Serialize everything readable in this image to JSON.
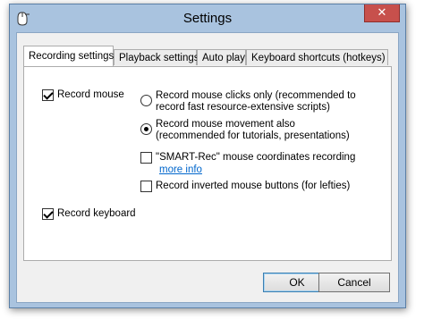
{
  "window": {
    "title": "Settings",
    "close_glyph": "✕"
  },
  "tabs": [
    {
      "label": "Recording settings",
      "active": true
    },
    {
      "label": "Playback settings",
      "active": false
    },
    {
      "label": "Auto play",
      "active": false
    },
    {
      "label": "Keyboard shortcuts (hotkeys)",
      "active": false
    }
  ],
  "options": {
    "record_mouse": {
      "label": "Record mouse",
      "checked": true
    },
    "mouse_clicks_only": {
      "line1": "Record mouse clicks only (recommended to",
      "line2": "record fast resource-extensive scripts)",
      "selected": false
    },
    "mouse_movement": {
      "line1": "Record mouse movement also",
      "line2": "(recommended for tutorials, presentations)",
      "selected": true
    },
    "smart_rec": {
      "label": "\"SMART-Rec\" mouse coordinates recording",
      "link": "more info",
      "checked": false
    },
    "inverted_buttons": {
      "label": "Record inverted mouse buttons (for lefties)",
      "checked": false
    },
    "record_keyboard": {
      "label": "Record keyboard",
      "checked": true
    }
  },
  "buttons": {
    "ok": "OK",
    "cancel": "Cancel"
  }
}
